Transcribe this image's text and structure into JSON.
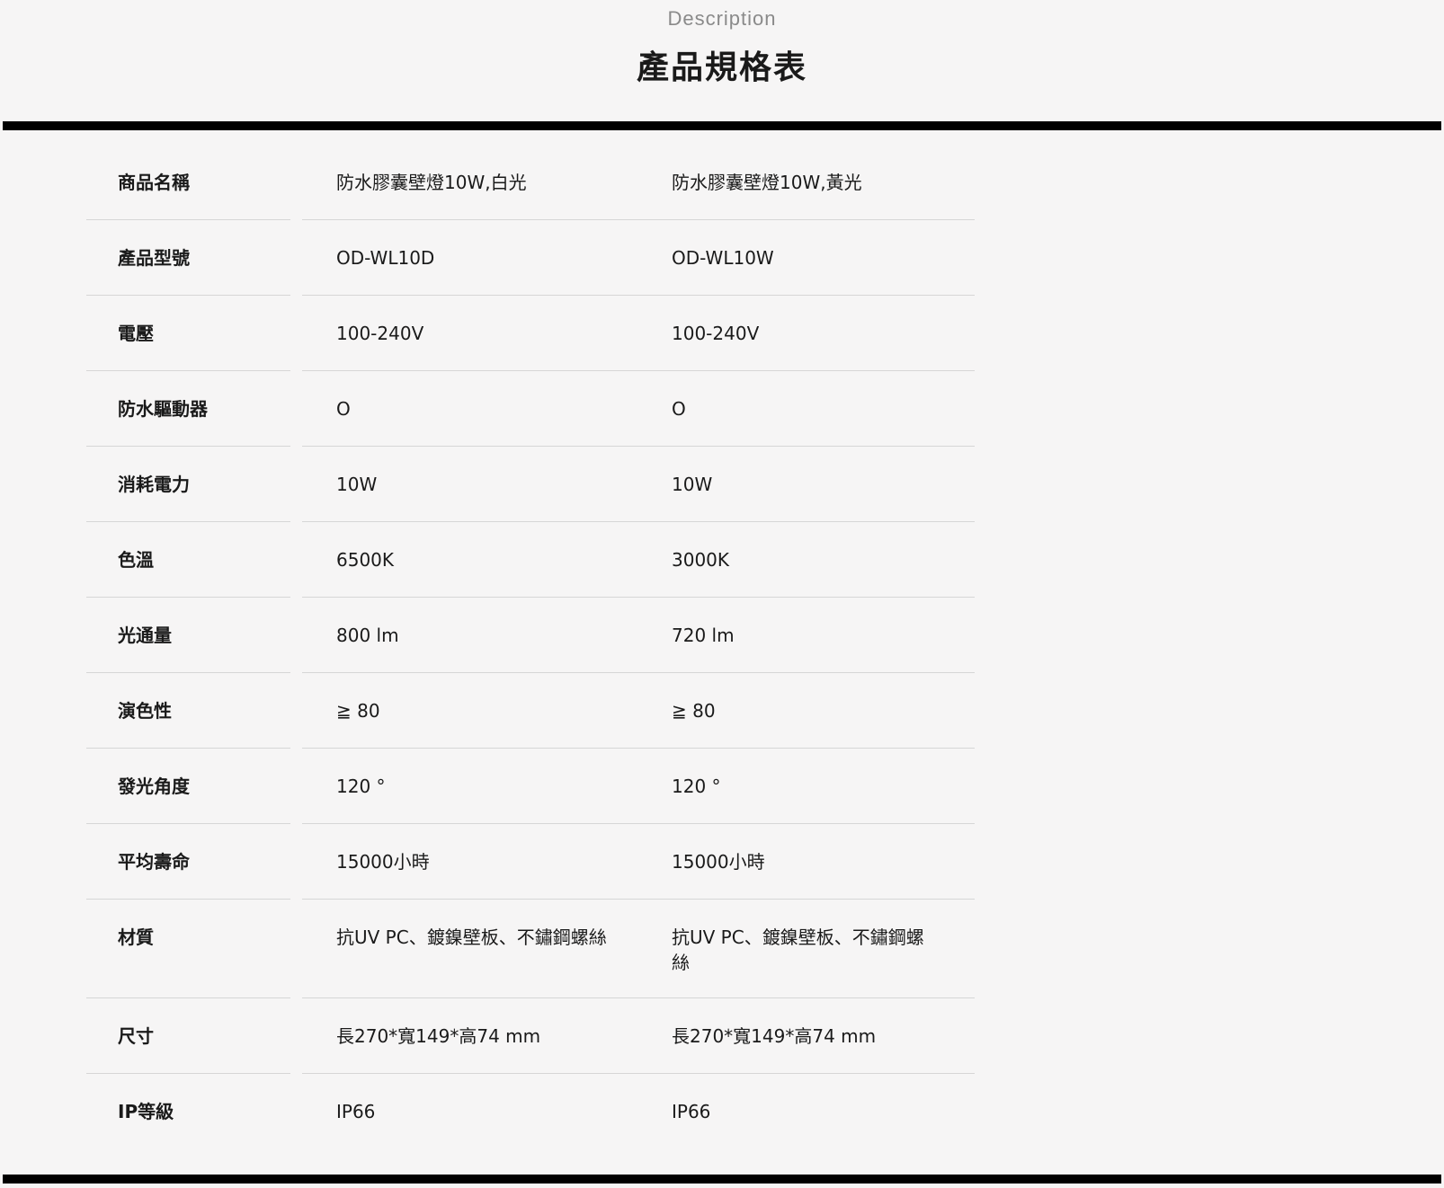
{
  "header": {
    "subtitle": "Description",
    "title": "產品規格表"
  },
  "specs": [
    {
      "label": "商品名稱",
      "v1": "防水膠囊壁燈10W,白光",
      "v2": "防水膠囊壁燈10W,黃光"
    },
    {
      "label": "產品型號",
      "v1": "OD-WL10D",
      "v2": "OD-WL10W"
    },
    {
      "label": "電壓",
      "v1": "100-240V",
      "v2": "100-240V"
    },
    {
      "label": "防水驅動器",
      "v1": "O",
      "v2": "O"
    },
    {
      "label": "消耗電力",
      "v1": "10W",
      "v2": "10W"
    },
    {
      "label": "色溫",
      "v1": "6500K",
      "v2": "3000K"
    },
    {
      "label": "光通量",
      "v1": "800 lm",
      "v2": "720 lm"
    },
    {
      "label": "演色性",
      "v1": "≧ 80",
      "v2": "≧ 80"
    },
    {
      "label": "發光角度",
      "v1": "120 °",
      "v2": "120 °"
    },
    {
      "label": "平均壽命",
      "v1": "15000小時",
      "v2": "15000小時"
    },
    {
      "label": "材質",
      "v1": "抗UV PC、鍍鎳壁板、不鏽鋼螺絲",
      "v2": "抗UV PC、鍍鎳壁板、不鏽鋼螺絲"
    },
    {
      "label": "尺寸",
      "v1": "長270*寬149*高74 mm",
      "v2": "長270*寬149*高74 mm"
    },
    {
      "label": "IP等級",
      "v1": "IP66",
      "v2": "IP66"
    }
  ]
}
